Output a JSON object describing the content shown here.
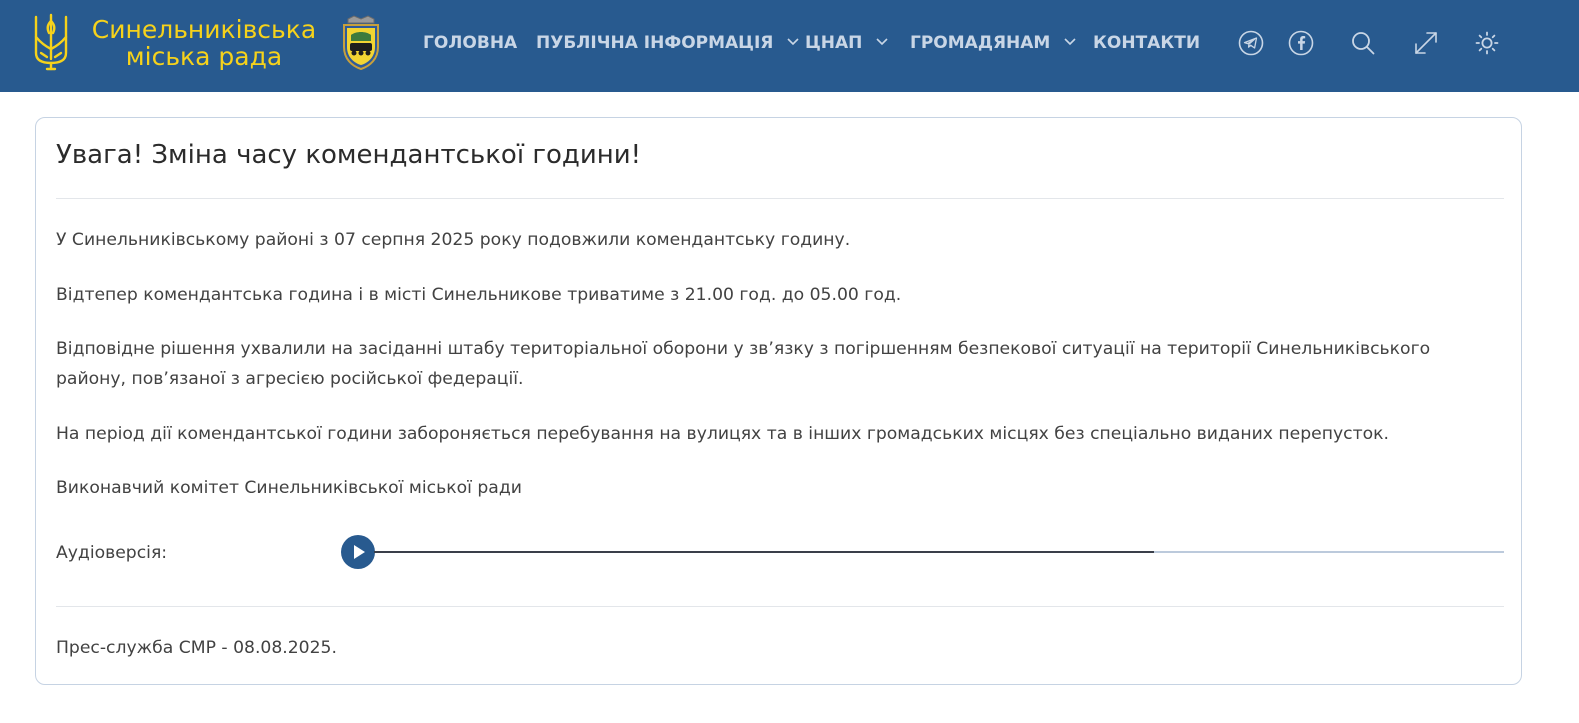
{
  "header": {
    "logo_line1": "Синельниківська",
    "logo_line2": "міська рада",
    "nav": [
      {
        "label": "ГОЛОВНА",
        "has_dropdown": false
      },
      {
        "label": "ПУБЛІЧНА ІНФОРМАЦІЯ",
        "has_dropdown": true
      },
      {
        "label": "ЦНАП",
        "has_dropdown": true
      },
      {
        "label": "ГРОМАДЯНАМ",
        "has_dropdown": true
      },
      {
        "label": "КОНТАКТИ",
        "has_dropdown": false
      }
    ],
    "icons": [
      "telegram-icon",
      "facebook-icon",
      "search-icon",
      "expand-icon",
      "theme-sun-icon"
    ]
  },
  "article": {
    "title": "Увага! Зміна часу комендантської години!",
    "paragraphs": [
      "У Синельниківському районі з 07 серпня 2025 року подовжили комендантську годину.",
      "Відтепер комендантська година і в місті Синельникове триватиме з 21.00 год. до 05.00 год.",
      "Відповідне рішення ухвалили на засіданні штабу територіальної оборони  у зв’язку з погіршенням безпекової  ситуації на території Синельниківського району, пов’язаної з агресією  російської федерації.",
      "На період дії комендантської години забороняється перебування на вулицях та в інших громадських місцях без спеціально виданих перепусток.",
      "Виконавчий комітет Синельниківської міської ради"
    ],
    "audio_label": "Аудіоверсія:",
    "audio_buffered_fraction": 0.69,
    "footer": "Прес-служба СМР - 08.08.2025."
  },
  "colors": {
    "header_bg": "#285a8f",
    "logo_yellow": "#f6d21b",
    "nav_text": "#c9d6e6",
    "card_border": "#c6d3e3"
  }
}
